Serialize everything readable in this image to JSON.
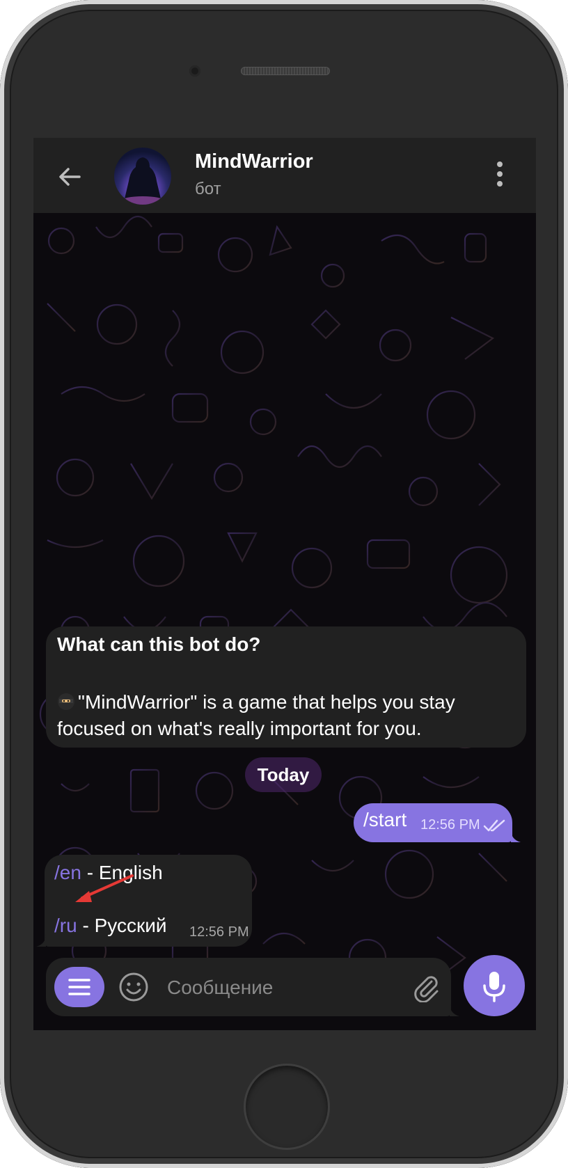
{
  "header": {
    "title": "MindWarrior",
    "subtitle": "бот",
    "back_icon": "arrow-left-icon",
    "menu_icon": "more-vertical-icon"
  },
  "bot_info": {
    "title": "What can this bot do?",
    "emoji": "ninja-emoji",
    "text": "\"MindWarrior\" is a game that helps you stay focused on what's really important for you."
  },
  "date_separator": "Today",
  "messages": [
    {
      "direction": "out",
      "text": "/start",
      "time": "12:56 PM",
      "status": "read"
    },
    {
      "direction": "in",
      "lines": [
        {
          "command": "/en",
          "separator": " - ",
          "label": "English"
        },
        {
          "command": "/ru",
          "separator": " - ",
          "label": "Русский"
        }
      ],
      "time": "12:56 PM"
    }
  ],
  "composer": {
    "placeholder": "Сообщение",
    "menu_icon": "bot-menu-icon",
    "emoji_icon": "smile-icon",
    "attach_icon": "paperclip-icon",
    "mic_icon": "microphone-icon"
  },
  "colors": {
    "accent": "#8774e1",
    "bubble": "#212121",
    "header": "#212121",
    "annotation_arrow": "#e53935"
  }
}
